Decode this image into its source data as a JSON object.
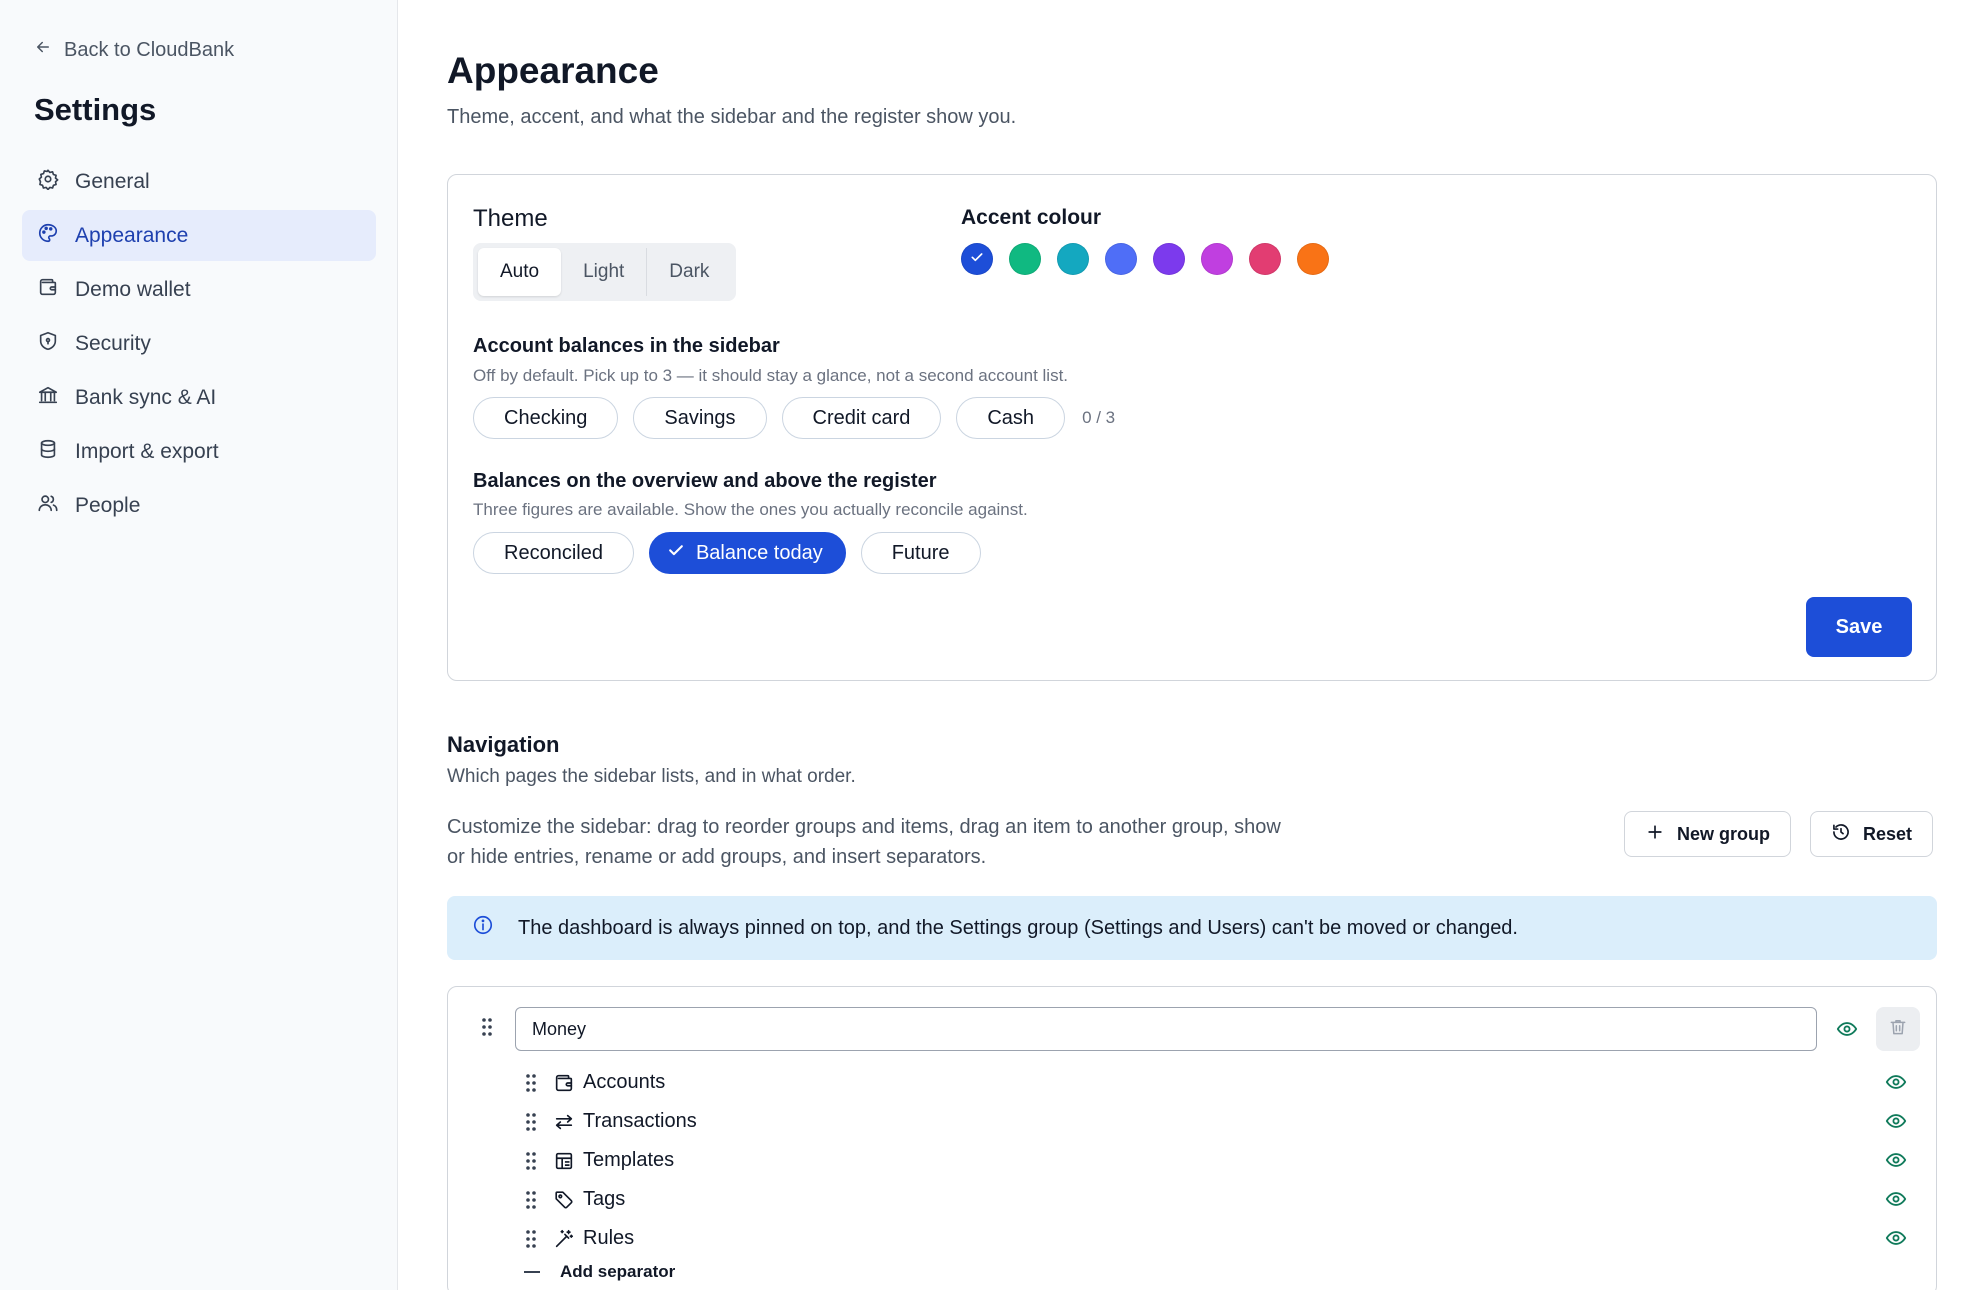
{
  "sidebar": {
    "back_label": "Back to CloudBank",
    "title": "Settings",
    "items": [
      {
        "label": "General",
        "icon": "gear-icon"
      },
      {
        "label": "Appearance",
        "icon": "palette-icon",
        "active": true
      },
      {
        "label": "Demo wallet",
        "icon": "wallet-icon"
      },
      {
        "label": "Security",
        "icon": "shield-icon"
      },
      {
        "label": "Bank sync & AI",
        "icon": "bank-icon"
      },
      {
        "label": "Import & export",
        "icon": "database-icon"
      },
      {
        "label": "People",
        "icon": "users-icon"
      }
    ]
  },
  "page": {
    "title": "Appearance",
    "subtitle": "Theme, accent, and what the sidebar and the register show you."
  },
  "theme": {
    "label": "Theme",
    "options": [
      "Auto",
      "Light",
      "Dark"
    ],
    "selected": "Auto"
  },
  "accent": {
    "label": "Accent colour",
    "colors": [
      "#1d4ed8",
      "#10b981",
      "#14a8c0",
      "#4f6ef7",
      "#7c3aed",
      "#c03fe0",
      "#e23d72",
      "#f97316"
    ],
    "selected_index": 0
  },
  "account_balances": {
    "heading": "Account balances in the sidebar",
    "hint": "Off by default. Pick up to 3 — it should stay a glance, not a second account list.",
    "options": [
      "Checking",
      "Savings",
      "Credit card",
      "Cash"
    ],
    "counter": "0 / 3"
  },
  "overview_balances": {
    "heading": "Balances on the overview and above the register",
    "hint": "Three figures are available. Show the ones you actually reconcile against.",
    "options": [
      "Reconciled",
      "Balance today",
      "Future"
    ],
    "selected": "Balance today"
  },
  "save_label": "Save",
  "navigation": {
    "heading": "Navigation",
    "subtitle": "Which pages the sidebar lists, and in what order.",
    "description": "Customize the sidebar: drag to reorder groups and items, drag an item to another group, show or hide entries, rename or add groups, and insert separators.",
    "new_group_label": "New group",
    "reset_label": "Reset",
    "info": "The dashboard is always pinned on top, and the Settings group (Settings and Users) can't be moved or changed.",
    "group": {
      "name": "Money",
      "items": [
        {
          "label": "Accounts",
          "icon": "wallet-icon"
        },
        {
          "label": "Transactions",
          "icon": "arrows-left-right-icon"
        },
        {
          "label": "Templates",
          "icon": "template-icon"
        },
        {
          "label": "Tags",
          "icon": "tag-icon"
        },
        {
          "label": "Rules",
          "icon": "wand-icon"
        }
      ],
      "add_separator_label": "Add separator"
    }
  },
  "colors": {
    "primary": "#1d4ed8",
    "eye_icon": "#0f7a5a",
    "info_bg": "#dbeefb"
  }
}
